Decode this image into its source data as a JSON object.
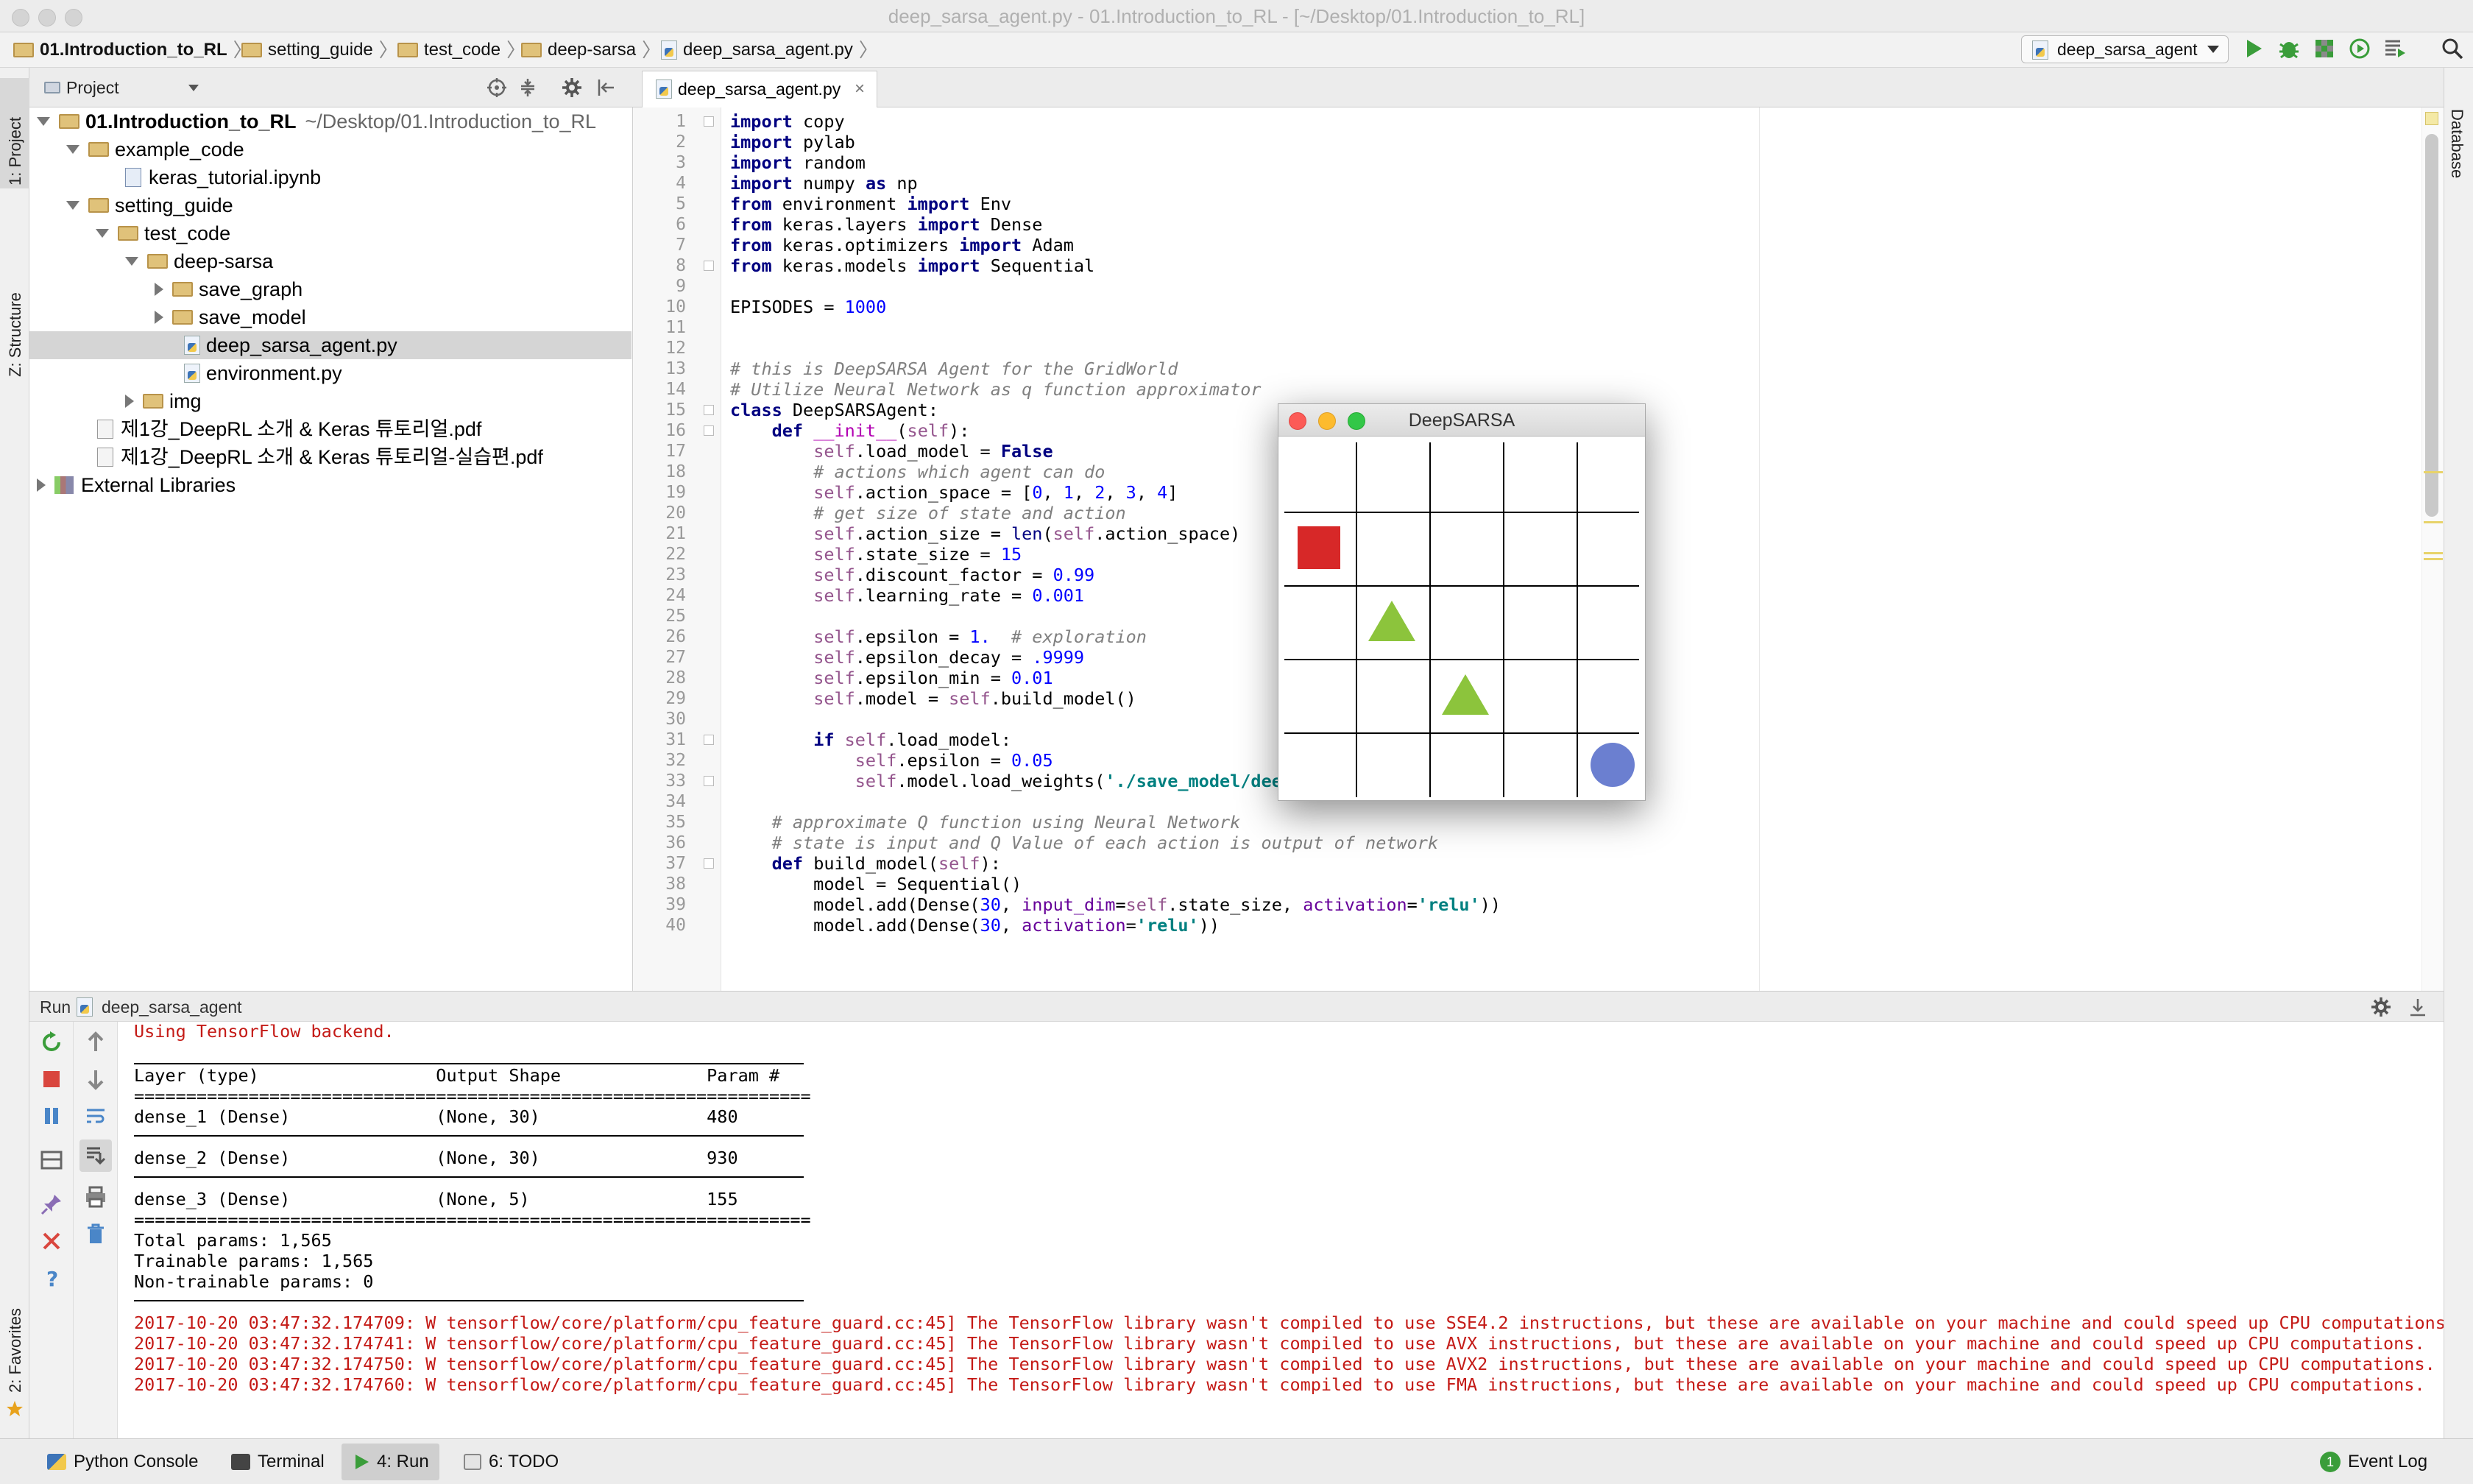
{
  "window": {
    "title": "deep_sarsa_agent.py - 01.Introduction_to_RL - [~/Desktop/01.Introduction_to_RL]"
  },
  "breadcrumb": [
    "01.Introduction_to_RL",
    "setting_guide",
    "test_code",
    "deep-sarsa",
    "deep_sarsa_agent.py"
  ],
  "toolbar": {
    "run_config": "deep_sarsa_agent"
  },
  "sidebar": {
    "project_tab": "1: Project",
    "structure_tab": "Z: Structure",
    "favorites_tab": "2: Favorites",
    "database_tab": "Database"
  },
  "project_panel": {
    "header": "Project",
    "root": {
      "label": "01.Introduction_to_RL",
      "path": "~/Desktop/01.Introduction_to_RL"
    },
    "items": [
      {
        "label": "example_code"
      },
      {
        "label": "keras_tutorial.ipynb"
      },
      {
        "label": "setting_guide"
      },
      {
        "label": "test_code"
      },
      {
        "label": "deep-sarsa"
      },
      {
        "label": "save_graph"
      },
      {
        "label": "save_model"
      },
      {
        "label": "deep_sarsa_agent.py"
      },
      {
        "label": "environment.py"
      },
      {
        "label": "img"
      },
      {
        "label": "제1강_DeepRL 소개 & Keras 튜토리얼.pdf"
      },
      {
        "label": "제1강_DeepRL 소개 & Keras 튜토리얼-실습편.pdf"
      },
      {
        "label": "External Libraries"
      }
    ]
  },
  "editor": {
    "tab": "deep_sarsa_agent.py",
    "line_numbers": [
      "1",
      "2",
      "3",
      "4",
      "5",
      "6",
      "7",
      "8",
      "9",
      "10",
      "11",
      "12",
      "13",
      "14",
      "15",
      "16",
      "17",
      "18",
      "19",
      "20",
      "21",
      "22",
      "23",
      "24",
      "25",
      "26",
      "27",
      "28",
      "29",
      "30",
      "31",
      "32",
      "33",
      "34",
      "35",
      "36",
      "37",
      "38",
      "39",
      "40"
    ],
    "code": [
      "import copy",
      "import pylab",
      "import random",
      "import numpy as np",
      "from environment import Env",
      "from keras.layers import Dense",
      "from keras.optimizers import Adam",
      "from keras.models import Sequential",
      "",
      "EPISODES = 1000",
      "",
      "",
      "# this is DeepSARSA Agent for the GridWorld",
      "# Utilize Neural Network as q function approximator",
      "class DeepSARSAgent:",
      "    def __init__(self):",
      "        self.load_model = False",
      "        # actions which agent can do",
      "        self.action_space = [0, 1, 2, 3, 4]",
      "        # get size of state and action",
      "        self.action_size = len(self.action_space)",
      "        self.state_size = 15",
      "        self.discount_factor = 0.99",
      "        self.learning_rate = 0.001",
      "",
      "        self.epsilon = 1.  # exploration",
      "        self.epsilon_decay = .9999",
      "        self.epsilon_min = 0.01",
      "        self.model = self.build_model()",
      "",
      "        if self.load_model:",
      "            self.epsilon = 0.05",
      "            self.model.load_weights('./save_model/deep_sarsa_trained.h5')",
      "",
      "    # approximate Q function using Neural Network",
      "    # state is input and Q Value of each action is output of network",
      "    def build_model(self):",
      "        model = Sequential()",
      "        model.add(Dense(30, input_dim=self.state_size, activation='relu'))",
      "        model.add(Dense(30, activation='relu'))"
    ]
  },
  "dialog": {
    "title": "DeepSARSA",
    "grid": {
      "rows": 5,
      "cols": 5
    }
  },
  "run_panel": {
    "title": "Run",
    "config": "deep_sarsa_agent",
    "lines": {
      "backend": "Using TensorFlow backend.",
      "header": "Layer (type)                 Output Shape              Param #",
      "rule_eq": "=================================================================",
      "dense1": "dense_1 (Dense)              (None, 30)                480",
      "dense2": "dense_2 (Dense)              (None, 30)                930",
      "dense3": "dense_3 (Dense)              (None, 5)                 155",
      "total": "Total params: 1,565",
      "trainable": "Trainable params: 1,565",
      "nontrainable": "Non-trainable params: 0",
      "warn1": "2017-10-20 03:47:32.174709: W tensorflow/core/platform/cpu_feature_guard.cc:45] The TensorFlow library wasn't compiled to use SSE4.2 instructions, but these are available on your machine and could speed up CPU computations.",
      "warn2": "2017-10-20 03:47:32.174741: W tensorflow/core/platform/cpu_feature_guard.cc:45] The TensorFlow library wasn't compiled to use AVX instructions, but these are available on your machine and could speed up CPU computations.",
      "warn3": "2017-10-20 03:47:32.174750: W tensorflow/core/platform/cpu_feature_guard.cc:45] The TensorFlow library wasn't compiled to use AVX2 instructions, but these are available on your machine and could speed up CPU computations.",
      "warn4": "2017-10-20 03:47:32.174760: W tensorflow/core/platform/cpu_feature_guard.cc:45] The TensorFlow library wasn't compiled to use FMA instructions, but these are available on your machine and could speed up CPU computations."
    }
  },
  "status_bar": {
    "python_console": "Python Console",
    "terminal": "Terminal",
    "run": "4: Run",
    "todo": "6: TODO",
    "event_log": "Event Log",
    "event_log_count": "1"
  },
  "colors": {
    "red_square": "#d72828",
    "green_triangle": "#8cc43c",
    "blue_circle": "#6b7fd0",
    "warning_text": "#c41a16",
    "selected_row": "#d5d5d5"
  }
}
